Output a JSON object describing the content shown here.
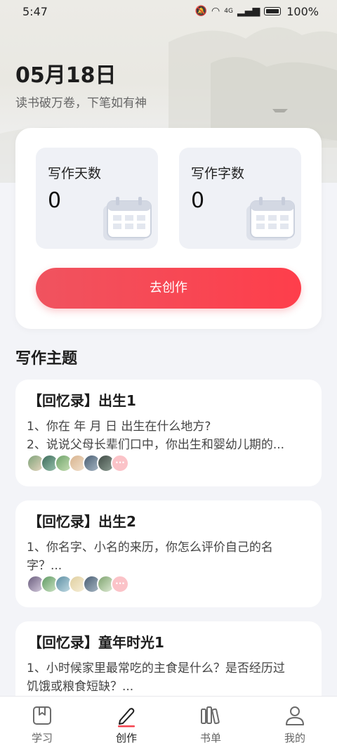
{
  "status_bar": {
    "time": "5:47",
    "network": "4G",
    "battery_percent": "100%"
  },
  "header": {
    "date": "05月18日",
    "motto": "读书破万卷，下笔如有神"
  },
  "stats": {
    "writing_days_label": "写作天数",
    "writing_days_value": "0",
    "writing_words_label": "写作字数",
    "writing_words_value": "0",
    "create_button": "去创作"
  },
  "topics_section": {
    "title": "写作主题",
    "items": [
      {
        "title": "【回忆录】出生1",
        "line1": "1、你在  年  月  日 出生在什么地方?",
        "line2": "2、说说父母长辈们口中，你出生和婴幼儿期的..."
      },
      {
        "title": "【回忆录】出生2",
        "line1": "1、你名字、小名的来历，你怎么评价自己的名",
        "line2": "字？..."
      },
      {
        "title": "【回忆录】童年时光1",
        "line1": "1、小时候家里最常吃的主食是什么？是否经历过",
        "line2": "饥饿或粮食短缺？..."
      }
    ],
    "more_label": "···"
  },
  "tabbar": {
    "tabs": [
      {
        "label": "学习",
        "icon": "bookmark-book-icon"
      },
      {
        "label": "创作",
        "icon": "pen-icon"
      },
      {
        "label": "书单",
        "icon": "bookshelf-icon"
      },
      {
        "label": "我的",
        "icon": "person-icon"
      }
    ],
    "active_index": 1
  },
  "colors": {
    "accent": "#f4434f",
    "background": "#f3f4f8"
  }
}
